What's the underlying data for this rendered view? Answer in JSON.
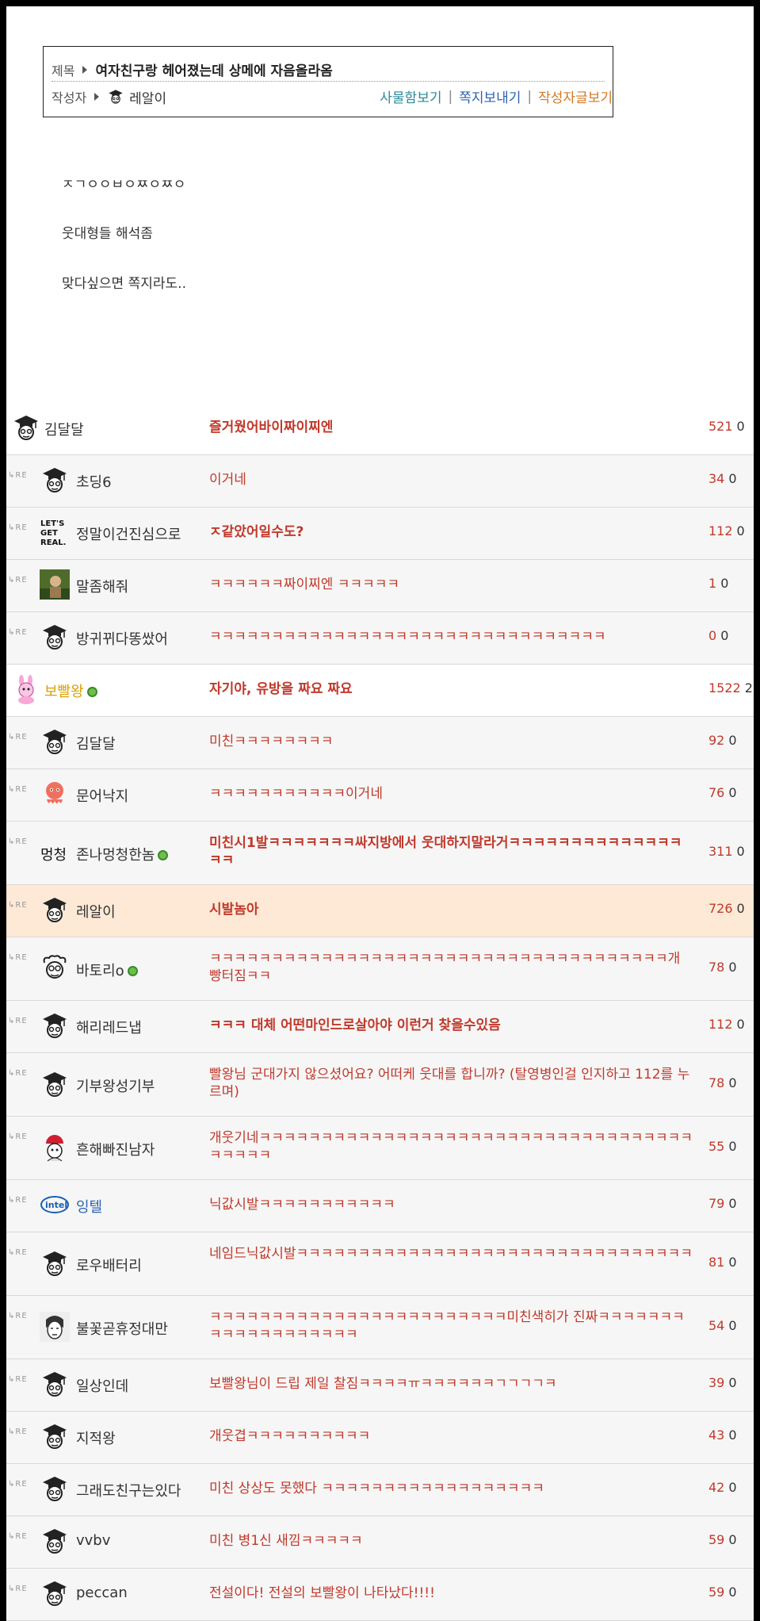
{
  "header": {
    "title_label": "제목",
    "title": "여자친구랑 헤어졌는데 상메에 자음올라옴",
    "author_label": "작성자",
    "author": "레알이",
    "links": [
      "사물함보기",
      "쪽지보내기",
      "작성자글보기"
    ],
    "link_separator": "|"
  },
  "body": [
    "ㅈㄱㅇㅇㅂㅇㅉㅇㅉㅇ",
    "웃대형들 해석좀",
    "맞다싶으면 쪽지라도.."
  ],
  "comments": [
    {
      "re": false,
      "avatar": "graduate-cap-icon",
      "nick": "김달달",
      "text": "즐거웠어바이짜이찌엔",
      "bold": true,
      "likes": "521",
      "replies": "0"
    },
    {
      "re": true,
      "avatar": "graduate-cap-icon",
      "nick": "초딩6",
      "text": "이거네",
      "bold": false,
      "likes": "34",
      "replies": "0"
    },
    {
      "re": true,
      "avatar": "lets-get-real-logo",
      "logo_text": "LET'S GET REAL.",
      "nick": "정말이건진심으로",
      "text": "ㅈ같았어일수도?",
      "bold": true,
      "likes": "112",
      "replies": "0"
    },
    {
      "re": true,
      "avatar": "photo-avatar",
      "nick": "말좀해줘",
      "text": "ㅋㅋㅋㅋㅋㅋ짜이찌엔 ㅋㅋㅋㅋㅋ",
      "bold": false,
      "likes": "1",
      "replies": "0"
    },
    {
      "re": true,
      "avatar": "graduate-cap-icon",
      "nick": "방귀뀌다똥쌌어",
      "text": "ㅋㅋㅋㅋㅋㅋㅋㅋㅋㅋㅋㅋㅋㅋㅋㅋㅋㅋㅋㅋㅋㅋㅋㅋㅋㅋㅋㅋㅋㅋㅋㅋ",
      "bold": false,
      "likes": "0",
      "replies": "0"
    },
    {
      "re": false,
      "avatar": "pink-rabbit-icon",
      "nick": "보빨왕",
      "nick_color": "gold",
      "badge": true,
      "text": "자기야, 유방을 짜요 짜요",
      "bold": true,
      "likes": "1522",
      "replies": "2"
    },
    {
      "re": true,
      "avatar": "graduate-cap-icon",
      "nick": "김달달",
      "text": "미친ㅋㅋㅋㅋㅋㅋㅋㅋ",
      "bold": false,
      "likes": "92",
      "replies": "0"
    },
    {
      "re": true,
      "avatar": "octopus-icon",
      "nick": "문어낙지",
      "text": "ㅋㅋㅋㅋㅋㅋㅋㅋㅋㅋㅋ이거네",
      "bold": false,
      "likes": "76",
      "replies": "0"
    },
    {
      "re": true,
      "avatar": "meongcheong-text-icon",
      "logo_text": "멍청",
      "nick": "존나멍청한놈",
      "badge": true,
      "text": "미친시1발ㅋㅋㅋㅋㅋㅋㅋ싸지방에서 웃대하지말라거ㅋㅋㅋㅋㅋㅋㅋㅋㅋㅋㅋㅋㅋㅋㅋㅋ",
      "bold": true,
      "likes": "311",
      "replies": "0"
    },
    {
      "re": true,
      "avatar": "graduate-cap-icon",
      "nick": "레알이",
      "highlight": true,
      "text": "시발놈아",
      "bold": true,
      "likes": "726",
      "replies": "0"
    },
    {
      "re": true,
      "avatar": "curly-face-icon",
      "nick": "바토리o",
      "badge": true,
      "text": "ㅋㅋㅋㅋㅋㅋㅋㅋㅋㅋㅋㅋㅋㅋㅋㅋㅋㅋㅋㅋㅋㅋㅋㅋㅋㅋㅋㅋㅋㅋㅋㅋㅋㅋㅋㅋㅋ개 빵터짐ㅋㅋ",
      "bold": false,
      "likes": "78",
      "replies": "0"
    },
    {
      "re": true,
      "avatar": "graduate-cap-icon",
      "nick": "해리레드냅",
      "text": "ㅋㅋㅋ 대체 어떤마인드로살아야 이런거 찾을수있음",
      "bold": true,
      "likes": "112",
      "replies": "0"
    },
    {
      "re": true,
      "avatar": "graduate-cap-icon",
      "nick": "기부왕성기부",
      "text": "빨왕님 군대가지 않으셨어요? 어떠케 웃대를 합니까? (탈영병인걸 인지하고 112를 누르며)",
      "bold": false,
      "likes": "78",
      "replies": "0"
    },
    {
      "re": true,
      "avatar": "taegeuk-face-icon",
      "nick": "흔해빠진남자",
      "text": "개웃기네ㅋㅋㅋㅋㅋㅋㅋㅋㅋㅋㅋㅋㅋㅋㅋㅋㅋㅋㅋㅋㅋㅋㅋㅋㅋㅋㅋㅋㅋㅋㅋㅋㅋㅋㅋㅋㅋㅋㅋㅋ",
      "bold": false,
      "likes": "55",
      "replies": "0"
    },
    {
      "re": true,
      "avatar": "intel-logo-icon",
      "logo_text": "intel",
      "nick": "잉텔",
      "nick_color": "blue",
      "text": "닉값시발ㅋㅋㅋㅋㅋㅋㅋㅋㅋㅋㅋ",
      "bold": false,
      "likes": "79",
      "replies": "0"
    },
    {
      "re": true,
      "avatar": "graduate-cap-icon",
      "nick": "로우배터리",
      "text": "네임드닉값시발ㅋㅋㅋㅋㅋㅋㅋㅋㅋㅋㅋㅋㅋㅋㅋㅋㅋㅋㅋㅋㅋㅋㅋㅋㅋㅋㅋㅋㅋㅋㅋㅋ",
      "bold": false,
      "likes": "81",
      "replies": "0"
    },
    {
      "re": true,
      "avatar": "sketch-face-icon",
      "nick": "불꽃곧휴정대만",
      "text": "ㅋㅋㅋㅋㅋㅋㅋㅋㅋㅋㅋㅋㅋㅋㅋㅋㅋㅋㅋㅋㅋㅋㅋㅋ미친색히가 진짜ㅋㅋㅋㅋㅋㅋㅋㅋㅋㅋㅋㅋㅋㅋㅋㅋㅋㅋㅋ",
      "bold": false,
      "likes": "54",
      "replies": "0"
    },
    {
      "re": true,
      "avatar": "graduate-cap-icon",
      "nick": "일상인데",
      "text": "보빨왕님이 드립 제일 찰짐ㅋㅋㅋㅋㅠㅋㅋㅋㅋㅋㅋㄱㄱㄱㄱㅋ",
      "bold": false,
      "likes": "39",
      "replies": "0"
    },
    {
      "re": true,
      "avatar": "graduate-cap-icon",
      "nick": "지적왕",
      "text": "개웃겹ㅋㅋㅋㅋㅋㅋㅋㅋㅋㅋ",
      "bold": false,
      "likes": "43",
      "replies": "0"
    },
    {
      "re": true,
      "avatar": "graduate-cap-icon",
      "nick": "그래도친구는있다",
      "text": "미친 상상도 못했다 ㅋㅋㅋㅋㅋㅋㅋㅋㅋㅋㅋㅋㅋㅋㅋㅋㅋㅋ",
      "bold": false,
      "likes": "42",
      "replies": "0"
    },
    {
      "re": true,
      "avatar": "graduate-cap-icon",
      "nick": "vvbv",
      "text": "미친 병1신 새낌ㅋㅋㅋㅋㅋ",
      "bold": false,
      "likes": "59",
      "replies": "0"
    },
    {
      "re": true,
      "avatar": "graduate-cap-icon",
      "nick": "peccan",
      "text": "전설이다! 전설의 보빨왕이 나타났다!!!!",
      "bold": false,
      "likes": "59",
      "replies": "0"
    }
  ],
  "re_label": "RE",
  "colors": {
    "comment": "#c0392b",
    "gold_nick": "#d8a000",
    "highlight_row": "#fde9d6",
    "link_box": "#2a8a9a",
    "link_msg": "#2b63b0",
    "link_posts": "#d07a22"
  }
}
